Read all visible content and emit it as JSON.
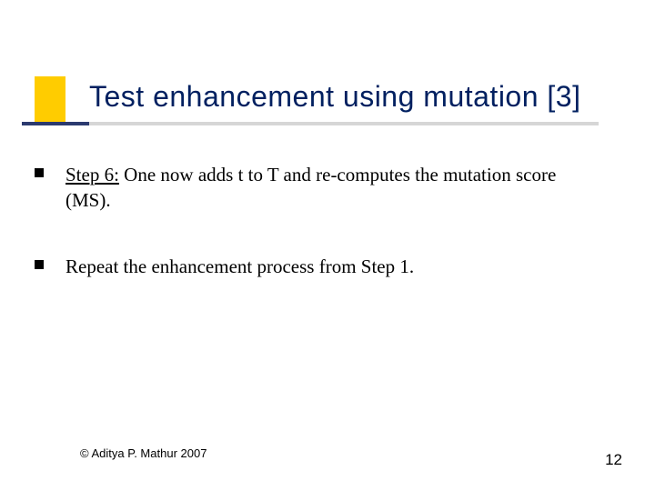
{
  "title": "Test enhancement using mutation [3]",
  "bullets": [
    {
      "lead_underlined": "Step 6:",
      "rest": " One now adds t to T and  re-computes the mutation score (MS)."
    },
    {
      "lead_underlined": "",
      "rest": "Repeat the enhancement process from Step 1."
    }
  ],
  "copyright": "© Aditya P. Mathur 2007",
  "page_number": "12"
}
